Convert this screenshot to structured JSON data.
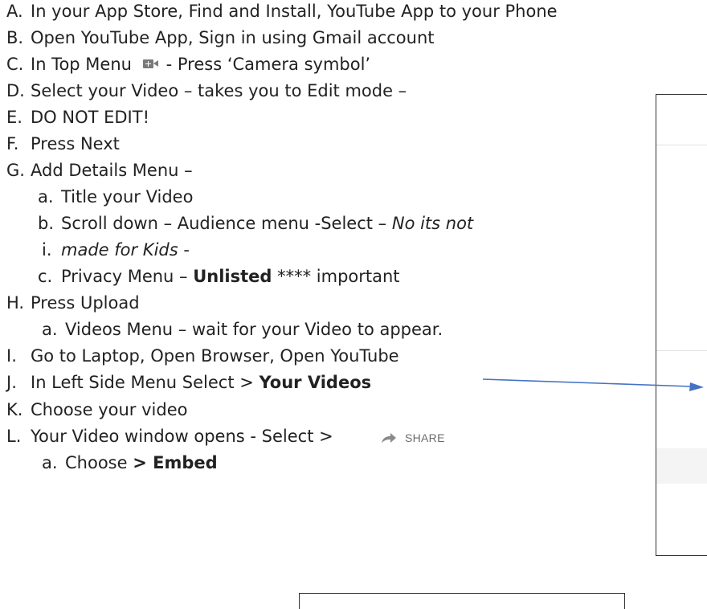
{
  "steps": [
    {
      "marker": "A.",
      "text": "In your App Store, Find and Install, YouTube App to your Phone"
    },
    {
      "marker": "B.",
      "text": "Open YouTube App, Sign in using Gmail account"
    },
    {
      "marker": "C.",
      "text_before": "In Top Menu",
      "text_after": " - Press  ‘Camera symbol’"
    },
    {
      "marker": "D.",
      "text": "Select your Video – takes you to Edit mode –"
    },
    {
      "marker": "E.",
      "text": "DO NOT EDIT!"
    },
    {
      "marker": "F.",
      "text": "Press Next"
    },
    {
      "marker": "G.",
      "text": "Add Details Menu –"
    },
    {
      "marker": "a.",
      "text": "Title your Video"
    },
    {
      "marker": "b.",
      "text_plain": "Scroll down – Audience menu -Select – ",
      "text_italic": "No its not"
    },
    {
      "marker": "i.",
      "text_italic": "made for Kids",
      "text_after": " -"
    },
    {
      "marker": "c.",
      "text_plain": "Privacy Menu – ",
      "text_bold": "Unlisted",
      "text_after": " **** important"
    },
    {
      "marker": "H.",
      "text": "Press Upload"
    },
    {
      "marker": "a.",
      "text": "Videos Menu – wait for your Video to appear."
    },
    {
      "marker": "I.",
      "text": "Go to Laptop, Open Browser, Open YouTube"
    },
    {
      "marker": "J.",
      "text_plain": "In Left Side Menu Select > ",
      "text_bold": "Your Videos"
    },
    {
      "marker": "K.",
      "text": "Choose your video"
    },
    {
      "marker": "L.",
      "text": "Your Video window opens - Select >"
    },
    {
      "marker": "a.",
      "text_plain": "Choose ",
      "text_bold": "> Embed"
    }
  ],
  "share_button": {
    "label": "SHARE",
    "icon": "share-arrow-icon"
  },
  "camera_icon": "add-video-camera-icon",
  "colors": {
    "text": "#222222",
    "arrow": "#4472C4",
    "frame": "#333333",
    "icon": "#7a7a7a"
  }
}
